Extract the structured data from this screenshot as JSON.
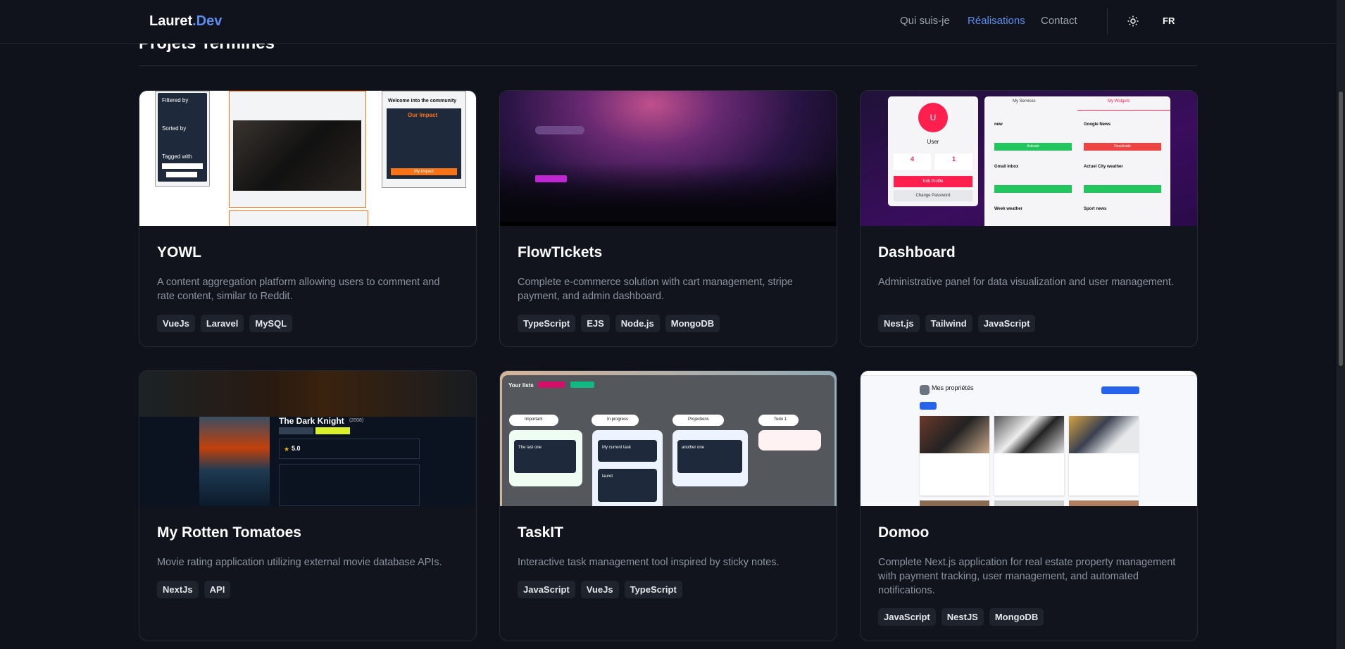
{
  "header": {
    "logo_main": "Lauret",
    "logo_accent": ".Dev",
    "nav": [
      "Qui suis-je",
      "Réalisations",
      "Contact"
    ],
    "lang": "FR"
  },
  "section_title": "Projets Terminés",
  "projects": [
    {
      "title": "YOWL",
      "description": "A content aggregation platform allowing users to comment and rate content, similar to Reddit.",
      "tags": [
        "VueJs",
        "Laravel",
        "MySQL"
      ],
      "thumb": {
        "filter": "Filtered by",
        "sorted": "Sorted by",
        "tagged": "Tagged with",
        "welcome": "Welcome into the community",
        "impact": "Our Impact",
        "btn": "My Impact"
      }
    },
    {
      "title": "FlowTIckets",
      "description": "Complete e-commerce solution with cart management, stripe payment, and admin dashboard.",
      "tags": [
        "TypeScript",
        "EJS",
        "Node.js",
        "MongoDB"
      ],
      "thumb": {}
    },
    {
      "title": "Dashboard",
      "description": "Administrative panel for data visualization and user management.",
      "tags": [
        "Nest.js",
        "Tailwind",
        "JavaScript"
      ],
      "thumb": {
        "avatar": "U",
        "user": "User",
        "services_count": "4",
        "widgets_count": "1",
        "edit": "Edit Profile",
        "change_pw": "Change Password",
        "tab1": "My Services",
        "tab2": "My Widgets",
        "w1": "new",
        "w2": "Google News",
        "w3": "Gmail Inbox",
        "w4": "Actuel City weather",
        "w5": "Week weather",
        "w6": "Sport news",
        "activate": "Activate",
        "deactivate": "Deactivate"
      }
    },
    {
      "title": "My Rotten Tomatoes",
      "description": "Movie rating application utilizing external movie database APIs.",
      "tags": [
        "NextJs",
        "API"
      ],
      "thumb": {
        "movie": "The Dark Knight",
        "year": "(2008)",
        "rating": "5.0"
      }
    },
    {
      "title": "TaskIT",
      "description": "Interactive task management tool inspired by sticky notes.",
      "tags": [
        "JavaScript",
        "VueJs",
        "TypeScript"
      ],
      "thumb": {
        "your_lists": "Your lists",
        "lists": [
          "Important",
          "In progress",
          "Projections",
          "Todo 1"
        ],
        "tasks": [
          "The last one",
          "My current task",
          "another one",
          "lauret"
        ]
      }
    },
    {
      "title": "Domoo",
      "description": "Complete Next.js application for real estate property management with payment tracking, user management, and automated notifications.",
      "tags": [
        "JavaScript",
        "NestJS",
        "MongoDB"
      ],
      "thumb": {
        "heading": "Mes propriétés"
      }
    }
  ]
}
